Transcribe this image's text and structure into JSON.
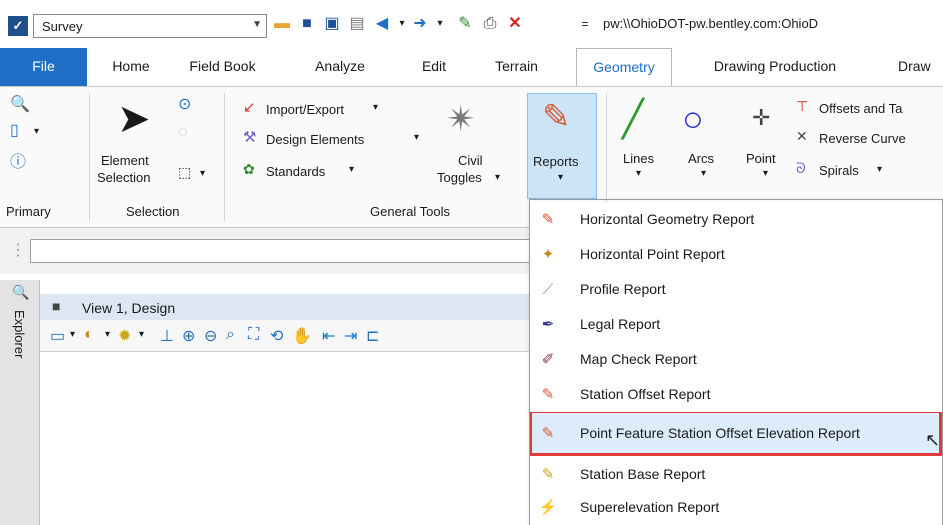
{
  "quick_access": {
    "workflow_value": "Survey",
    "path_text": "pw:\\\\OhioDOT-pw.bentley.com:OhioD"
  },
  "tabs": [
    {
      "label": "File"
    },
    {
      "label": "Home"
    },
    {
      "label": "Field Book"
    },
    {
      "label": "Analyze"
    },
    {
      "label": "Edit"
    },
    {
      "label": "Terrain"
    },
    {
      "label": "Geometry"
    },
    {
      "label": "Drawing Production"
    },
    {
      "label": "Draw"
    }
  ],
  "ribbon": {
    "groups": {
      "primary": "Primary",
      "selection": "Selection",
      "general_tools": "General Tools"
    },
    "element_selection_line1": "Element",
    "element_selection_line2": "Selection",
    "import_export": "Import/Export",
    "design_elements": "Design Elements",
    "standards": "Standards",
    "civil_line1": "Civil",
    "civil_line2": "Toggles",
    "reports": "Reports",
    "lines": "Lines",
    "arcs": "Arcs",
    "point": "Point",
    "offsets": "Offsets and Ta",
    "reverse_curve": "Reverse Curve",
    "spirals": "Spirals"
  },
  "view": {
    "title": "View 1, Design",
    "explorer_label": "Explorer"
  },
  "menu": {
    "items": [
      {
        "label": "Horizontal Geometry Report"
      },
      {
        "label": "Horizontal Point Report"
      },
      {
        "label": "Profile Report"
      },
      {
        "label": "Legal Report"
      },
      {
        "label": "Map Check Report"
      },
      {
        "label": "Station Offset Report"
      },
      {
        "label": "Point Feature Station Offset Elevation Report"
      },
      {
        "label": "Station Base Report"
      },
      {
        "label": "Superelevation Report"
      }
    ],
    "highlighted_index": 6
  },
  "colors": {
    "file_tab": "#1e6fc5",
    "highlight_border": "#e03a3a",
    "highlight_fill": "#dcecfb"
  }
}
